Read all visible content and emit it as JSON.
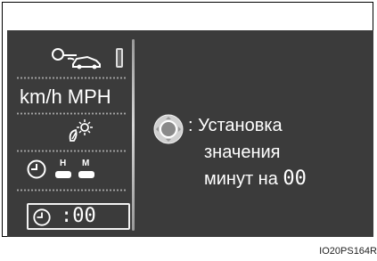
{
  "display": {
    "speed_units": "km/h  MPH",
    "clock_seg_time": ":00"
  },
  "instruction": {
    "line1": ": Установка",
    "line2": "значения",
    "line3_prefix": "минут на",
    "line3_value": "00"
  },
  "icons": [
    "driver-vehicle-icon",
    "indicator-bar-icon",
    "light-sensor-icon",
    "clock-icon",
    "hour-button-icon",
    "minute-button-icon",
    "adjust-knob-icon"
  ],
  "labels": {
    "hour_key": "H",
    "minute_key": "M"
  },
  "figure_code": "IO20PS164R",
  "colors": {
    "screen_bg": "#3b3b3b",
    "text": "#ffffff"
  }
}
